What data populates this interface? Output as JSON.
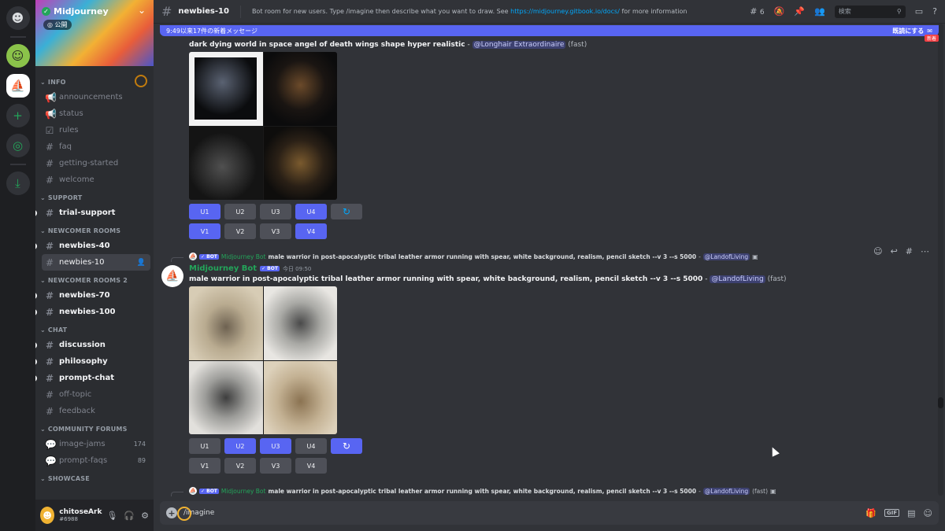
{
  "guilds": {
    "items": [
      {
        "name": "discord-home",
        "glyph": "☻"
      },
      {
        "name": "green-face-server",
        "glyph": "☺"
      },
      {
        "name": "midjourney-server",
        "glyph": "⛵"
      },
      {
        "name": "add-server",
        "glyph": "+"
      },
      {
        "name": "explore-servers",
        "glyph": "◎"
      },
      {
        "name": "download-apps",
        "glyph": "⤓"
      }
    ]
  },
  "server": {
    "name": "Midjourney",
    "public_badge": "公開"
  },
  "sidebar": {
    "categories": [
      {
        "label": "INFO",
        "channels": [
          {
            "label": "announcements",
            "icon": "📢",
            "state": "muted"
          },
          {
            "label": "status",
            "icon": "📢",
            "state": "muted"
          },
          {
            "label": "rules",
            "icon": "☑",
            "state": "muted"
          },
          {
            "label": "faq",
            "icon": "#",
            "state": "muted"
          },
          {
            "label": "getting-started",
            "icon": "#",
            "state": "muted"
          },
          {
            "label": "welcome",
            "icon": "#",
            "state": "muted"
          }
        ]
      },
      {
        "label": "SUPPORT",
        "channels": [
          {
            "label": "trial-support",
            "icon": "#",
            "state": "unread"
          }
        ]
      },
      {
        "label": "NEWCOMER ROOMS",
        "channels": [
          {
            "label": "newbies-40",
            "icon": "#",
            "state": "unread"
          },
          {
            "label": "newbies-10",
            "icon": "#",
            "state": "selected"
          }
        ]
      },
      {
        "label": "NEWCOMER ROOMS 2",
        "channels": [
          {
            "label": "newbies-70",
            "icon": "#",
            "state": "unread"
          },
          {
            "label": "newbies-100",
            "icon": "#",
            "state": "unread"
          }
        ]
      },
      {
        "label": "CHAT",
        "channels": [
          {
            "label": "discussion",
            "icon": "#",
            "state": "unread"
          },
          {
            "label": "philosophy",
            "icon": "#",
            "state": "unread"
          },
          {
            "label": "prompt-chat",
            "icon": "#",
            "state": "unread"
          },
          {
            "label": "off-topic",
            "icon": "#",
            "state": "muted"
          },
          {
            "label": "feedback",
            "icon": "#",
            "state": "muted"
          }
        ]
      },
      {
        "label": "COMMUNITY FORUMS",
        "channels": [
          {
            "label": "image-jams",
            "icon": "💬",
            "state": "muted",
            "count": "174"
          },
          {
            "label": "prompt-faqs",
            "icon": "💬",
            "state": "muted",
            "count": "89"
          }
        ]
      },
      {
        "label": "SHOWCASE",
        "channels": []
      }
    ]
  },
  "user": {
    "name": "chitoseArk",
    "tag": "#6988"
  },
  "header": {
    "channel": "newbies-10",
    "topic_prefix": "Bot room for new users. Type /imagine then describe what you want to draw. See ",
    "topic_link": "https://midjourney.gitbook.io/docs/",
    "topic_suffix": " for more information",
    "threads_count": "6",
    "search_placeholder": "検索"
  },
  "new_messages_bar": {
    "text": "9:49以来17件の新着メッセージ",
    "mark_read": "既読にする",
    "new_badge": "新着"
  },
  "messages": [
    {
      "prompt": "dark dying world in space angel of death wings shape hyper realistic",
      "sep": " - ",
      "mention": "@Longhair Extraordinaire",
      "speed": "(fast)",
      "upscale": [
        {
          "label": "U1",
          "active": true
        },
        {
          "label": "U2",
          "active": false
        },
        {
          "label": "U3",
          "active": false
        },
        {
          "label": "U4",
          "active": true
        }
      ],
      "variation": [
        {
          "label": "V1",
          "active": true
        },
        {
          "label": "V2",
          "active": false
        },
        {
          "label": "V3",
          "active": false
        },
        {
          "label": "V4",
          "active": true
        }
      ],
      "refresh_active": false
    },
    {
      "reply": {
        "author": "Midjourney Bot",
        "bot_tag": "✓ BOT",
        "prompt": "male warrior in post-apocalyptic tribal leather armor running with spear, white background, realism, pencil sketch --v 3 --s 5000",
        "sep": " - ",
        "mention": "@LandofLiving"
      },
      "author": "Midjourney Bot",
      "bot_tag": "✓ BOT",
      "time": "今日 09:50",
      "prompt": "male warrior in post-apocalyptic tribal leather armor running with spear, white background, realism, pencil sketch --v 3 --s 5000",
      "sep": " - ",
      "mention": "@LandofLiving",
      "speed": "(fast)",
      "upscale": [
        {
          "label": "U1",
          "active": false
        },
        {
          "label": "U2",
          "active": true
        },
        {
          "label": "U3",
          "active": true
        },
        {
          "label": "U4",
          "active": false
        }
      ],
      "variation": [
        {
          "label": "V1",
          "active": false
        },
        {
          "label": "V2",
          "active": false
        },
        {
          "label": "V3",
          "active": false
        },
        {
          "label": "V4",
          "active": false
        }
      ],
      "refresh_active": true
    },
    {
      "reply": {
        "author": "Midjourney Bot",
        "bot_tag": "✓ BOT",
        "prompt": "male warrior in post-apocalyptic tribal leather armor running with spear, white background, realism, pencil sketch --v 3 --s 5000",
        "sep": " - ",
        "mention": "@LandofLiving",
        "speed": "(fast)"
      }
    }
  ],
  "composer": {
    "value": "/imagine"
  },
  "colors": {
    "accent": "#5865f2",
    "bot_green": "#23a55a",
    "background": "#313338",
    "sidebar": "#2b2d31",
    "guild_bar": "#1e1f22"
  }
}
